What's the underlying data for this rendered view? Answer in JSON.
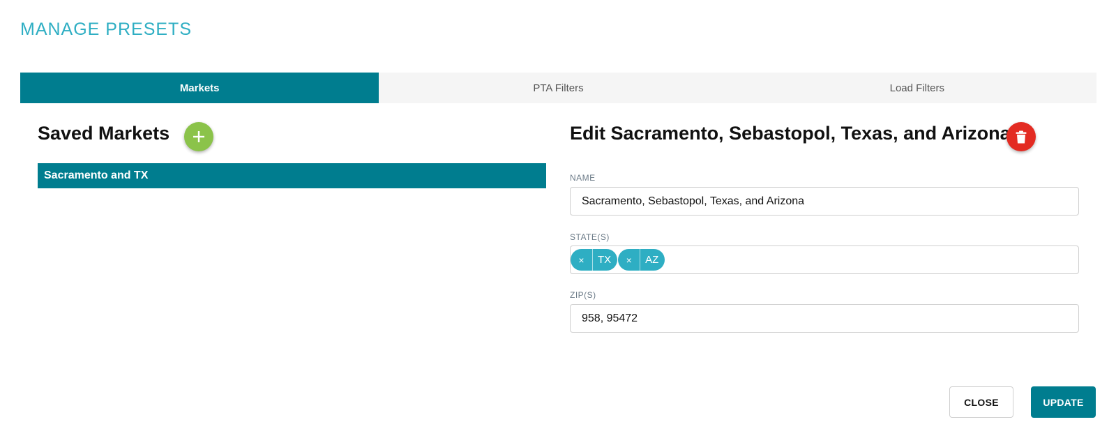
{
  "dialog": {
    "title": "MANAGE PRESETS"
  },
  "tabs": [
    {
      "label": "Markets",
      "active": true
    },
    {
      "label": "PTA Filters",
      "active": false
    },
    {
      "label": "Load Filters",
      "active": false
    }
  ],
  "saved_markets": {
    "heading": "Saved Markets",
    "add_icon": "plus-icon",
    "items": [
      {
        "label": "Sacramento and TX",
        "selected": true
      }
    ]
  },
  "editor": {
    "heading": "Edit Sacramento, Sebastopol, Texas, and Arizona",
    "delete_icon": "trash-icon",
    "name": {
      "label": "NAME",
      "value": "Sacramento, Sebastopol, Texas, and Arizona"
    },
    "states": {
      "label": "STATE(S)",
      "tags": [
        {
          "remove": "×",
          "label": "TX"
        },
        {
          "remove": "×",
          "label": "AZ"
        }
      ]
    },
    "zips": {
      "label": "ZIP(S)",
      "value": "958, 95472"
    }
  },
  "footer": {
    "close_label": "CLOSE",
    "update_label": "UPDATE"
  },
  "colors": {
    "accent_teal": "#007d8f",
    "title_teal": "#2eaec3",
    "add_green": "#8bc34a",
    "delete_red": "#e32b22"
  }
}
